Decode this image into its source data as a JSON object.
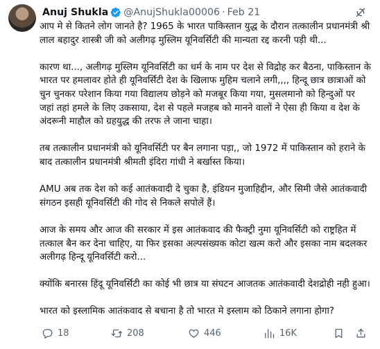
{
  "author": {
    "name": "Anuj Shukla",
    "handle": "@AnujShukla00006",
    "separator": "·",
    "date": "Feb 21"
  },
  "tweet": {
    "paragraphs": [
      "आप मे से कितने लोग जानते है? 1965 के भारत पाकिस्तान युद्ध के दौरान तत्कालीन प्रधानमंत्री श्री लाल बहादुर शास्त्री जी को अलीगढ़ मुस्लिम यूनिवर्सिटी की मान्यता रद्द करनी पड़ी थी...",
      "कारण था..., अलीगढ़ मुस्लिम यूनिवर्सिटी का धर्म के नाम पर देश से विद्रोह कर बैठना, पाकिस्तान के भारत पर हमलावर होते ही यूनिवर्सिटी देश के खिलाफ मुहिम चलाने लगी,,,, हिन्दू छात्र छात्राओं को चुन चुनकर परेशान किया गया विद्यालय छोड़ने को मजबूर किया गया, मुसलमानो को हिन्दुओं पर जहां तहां हमले के लिए उकसाया, देश से पहले मजहब को मानने वालों ने ऐसा ही किया व देश के अंदरूनी माहौल को ग्रहयुद्ध की तरफ ले जाना चाहा।",
      "तब तत्कालीन प्रधानमंत्री को यूनिवर्सिटी पर बैन लगाना पड़ा,, जो 1972 में पाकिस्तान को हराने के बाद तत्कालीन प्रधानमंत्री श्रीमती इंदिरा गांधी ने बर्खास्त किया।",
      "AMU अब तक देश को कई आतंकवादी दे चुका है, इंडियन मुजाहिद्दीन, और सिमी जैसे आतंकवादी संगठन इसही यूनिवर्सिटी की गोद से निकले सपोलें हैं।",
      "आज के समय और आज की सरकार में इस आतंकवाद की फैक्ट्री नुमा यूनिवर्सिटी को राष्ट्रहित में तत्काल बैन कर देना चाहिए, या फिर इसका अल्पसंख्यक कोटा खत्म करो और इसका नाम बदलकर अलीगढ़ हिन्दू यूनिवर्सिटी करो...",
      "क्योंकि बनारस हिंदू यूनिवर्सिटी का कोई भी छात्र या संघटन आजतक आतंकवादी देशद्रोही नही हुआ।",
      "भारत को इस्लामिक आतंकवाद से बचाना है तो भारत मे इस्लाम को ठिकाने लगाना होगा?"
    ]
  },
  "actions": {
    "replies": "18",
    "reposts": "208",
    "likes": "446",
    "views": "16K"
  },
  "icons": {
    "verified": "verified-badge-icon",
    "grok": "grok-icon",
    "reply": "reply-icon",
    "repost": "repost-icon",
    "like": "heart-icon",
    "views": "views-icon",
    "bookmark": "bookmark-icon",
    "share": "share-icon"
  },
  "colors": {
    "verified": "#1d9bf0",
    "text": "#0f1419",
    "muted": "#536471"
  }
}
